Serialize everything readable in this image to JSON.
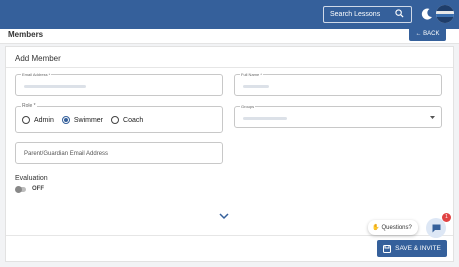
{
  "topbar": {
    "search_placeholder": "Search Lessons",
    "accent_color": "#35609b"
  },
  "page": {
    "title": "Members",
    "back_label": "BACK"
  },
  "form": {
    "title": "Add Member",
    "email_label": "Email Address *",
    "full_name_label": "Full Name *",
    "role_label": "Role *",
    "role_options": [
      "Admin",
      "Swimmer",
      "Coach"
    ],
    "role_selected": "Swimmer",
    "groups_label": "Groups",
    "guardian_placeholder": "Parent/Guardian Email Address",
    "evaluation_title": "Evaluation",
    "evaluation_state": "OFF"
  },
  "footer": {
    "save_label": "SAVE & INVITE",
    "questions_label": "Questions?",
    "chat_badge": "1"
  }
}
